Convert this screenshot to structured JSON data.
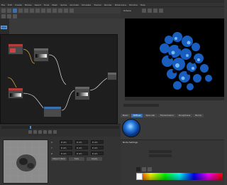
{
  "menu": {
    "items": [
      "File",
      "Edit",
      "Create",
      "Modes",
      "Select",
      "Tools",
      "Mesh",
      "Spline",
      "Animate",
      "Simulate",
      "Tracker",
      "Render",
      "Extensions",
      "Window",
      "Help"
    ]
  },
  "node_editor": {
    "nodes": [
      {
        "id": "color-node-a"
      },
      {
        "id": "gradient-node"
      },
      {
        "id": "color-node-b"
      },
      {
        "id": "gradient-node-2"
      },
      {
        "id": "blend-node"
      },
      {
        "id": "output-node"
      }
    ]
  },
  "viewport_header": {
    "mode_label": "Octane"
  },
  "attributes": {
    "rows": [
      {
        "label": "X",
        "value": "0 cm"
      },
      {
        "label": "Y",
        "value": "0 cm"
      },
      {
        "label": "Z",
        "value": "0 cm"
      }
    ],
    "buttons": [
      "Object (Rel)",
      "Size",
      "Apply"
    ]
  },
  "material": {
    "tabs": [
      "Basic",
      "Diffuse",
      "Specular",
      "Transmission",
      "Roughness",
      "Bump"
    ],
    "active_tab": 1
  },
  "node_settings": {
    "title": "Node Settings"
  },
  "colors": {
    "accent": "#3a6fb0",
    "viewport_bg": "#000000"
  }
}
